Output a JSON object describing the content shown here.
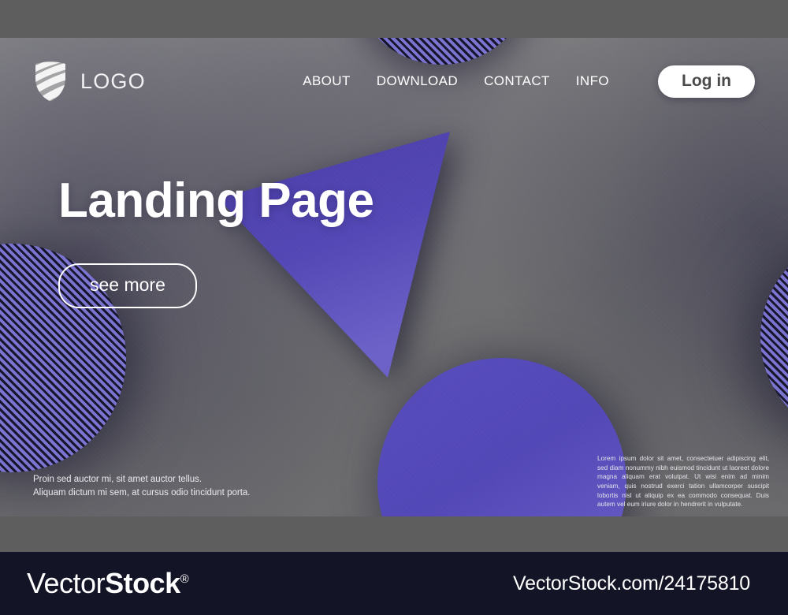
{
  "preview": {
    "kind": "stock-vector-preview",
    "watermark_brand_light": "Vector",
    "watermark_brand_bold": "Stock",
    "watermark_registered": "®",
    "watermark_url": "VectorStock.com/24175810"
  },
  "header": {
    "logo_icon": "shield-icon",
    "brand_name": "LOGO",
    "nav_items": [
      {
        "label": "ABOUT"
      },
      {
        "label": "DOWNLOAD"
      },
      {
        "label": "CONTACT"
      },
      {
        "label": "INFO"
      }
    ],
    "login_label": "Log in"
  },
  "hero": {
    "title": "Landing Page",
    "cta_label": "see more"
  },
  "body_copy": {
    "left_line_1": "Proin sed auctor mi, sit amet auctor tellus.",
    "left_line_2": "Aliquam dictum mi sem, at cursus odio tincidunt porta.",
    "right_paragraph": "Lorem ipsum dolor sit amet, consectetuer adipiscing elit, sed diam nonummy nibh euismod tincidunt ut laoreet dolore magna aliquam erat volutpat. Ut wisi enim ad minim veniam, quis nostrud exerci tation ullamcorper suscipit lobortis nisl ut aliquip ex ea commodo consequat. Duis autem vel eum iriure dolor in hendrerit in vulputate."
  },
  "shapes": [
    {
      "name": "striped-circle-top",
      "style": "striped",
      "color": "#6f68c4"
    },
    {
      "name": "striped-circle-left",
      "style": "striped",
      "color": "#6f68c4"
    },
    {
      "name": "striped-circle-right",
      "style": "striped",
      "color": "#6f68c4"
    },
    {
      "name": "solid-circle-bottom",
      "style": "solid",
      "color": "#5247b6"
    },
    {
      "name": "purple-triangle",
      "style": "solid",
      "color": "#4f41ab"
    }
  ],
  "colors": {
    "background_gray": "#6b6b6b",
    "surround_gray": "#5e5e5e",
    "accent_purple": "#4f41ab",
    "accent_purple_light": "#6f68c4",
    "stripe_dark": "#17152c",
    "footer_navy": "#131425",
    "text_white": "#ffffff",
    "login_text": "#4a4a4a"
  }
}
